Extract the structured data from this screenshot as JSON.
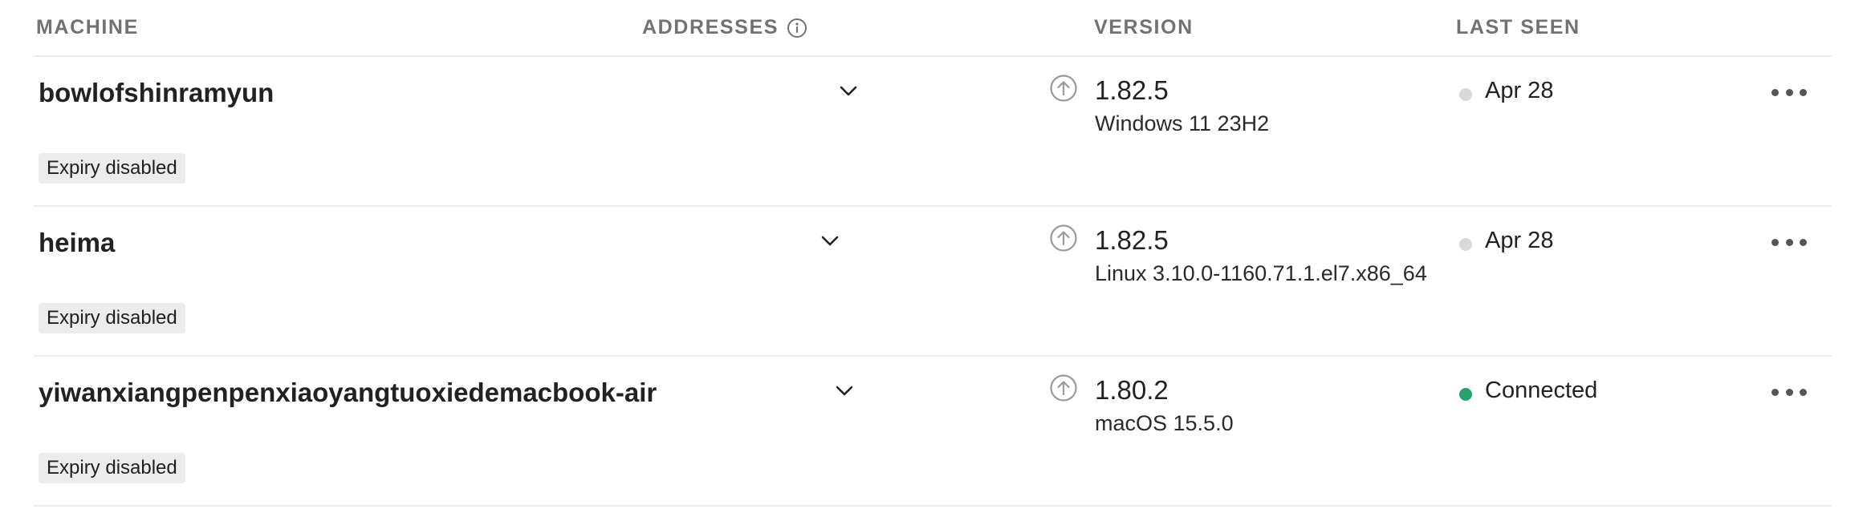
{
  "header": {
    "machine": "MACHINE",
    "addresses": "ADDRESSES",
    "version": "VERSION",
    "last_seen": "LAST SEEN"
  },
  "rows": [
    {
      "name": "bowlofshinramyun",
      "badge": "Expiry disabled",
      "version": "1.82.5",
      "os": "Windows 11 23H2",
      "status": "Apr 28",
      "status_state": "offline"
    },
    {
      "name": "heima",
      "badge": "Expiry disabled",
      "version": "1.82.5",
      "os": "Linux 3.10.0-1160.71.1.el7.x86_64",
      "status": "Apr 28",
      "status_state": "offline"
    },
    {
      "name": "yiwanxiangpenpenxiaoyangtuoxiedemacbook-air",
      "badge": "Expiry disabled",
      "version": "1.80.2",
      "os": "macOS 15.5.0",
      "status": "Connected",
      "status_state": "connected"
    }
  ],
  "icons": {
    "info": "info-icon",
    "expand": "chevron-down-icon",
    "update": "update-available-icon",
    "menu": "more-horizontal-icon"
  },
  "colors": {
    "header_text": "#727272",
    "divider": "#ececec",
    "badge_bg": "#ececec",
    "offline_dot": "#d9d9d9",
    "connected_dot": "#27a36b",
    "icon_gray": "#9a9a9a"
  }
}
